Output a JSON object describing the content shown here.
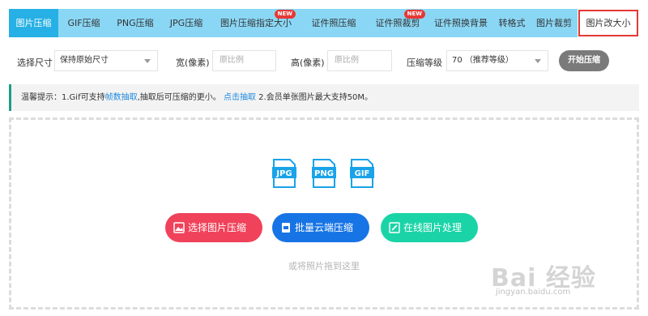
{
  "tabs": [
    {
      "label": "图片压缩"
    },
    {
      "label": "GIF压缩"
    },
    {
      "label": "PNG压缩"
    },
    {
      "label": "JPG压缩"
    },
    {
      "label": "图片压缩指定大小",
      "badge": "NEW"
    },
    {
      "label": "证件照压缩"
    },
    {
      "label": "证件照裁剪",
      "badge": "NEW"
    },
    {
      "label": "证件照换背景"
    },
    {
      "label": "转格式"
    },
    {
      "label": "图片裁剪"
    },
    {
      "label": "图片改大小"
    }
  ],
  "options": {
    "size_label": "选择尺寸",
    "size_value": "保持原始尺寸",
    "width_label": "宽(像素)",
    "width_placeholder": "原比例",
    "height_label": "高(像素)",
    "height_placeholder": "原比例",
    "level_label": "压缩等级",
    "level_value": "70 （推荐等级）",
    "start_button": "开始压缩"
  },
  "tip": {
    "text1": "温馨提示：1.Gif可支持",
    "link1": "帧数抽取",
    "text2": ",抽取后可压缩的更小。",
    "link2": "点击抽取",
    "text3": " 2.会员单张图片最大支持50M。"
  },
  "formats": [
    "JPG",
    "PNG",
    "GIF"
  ],
  "actions": {
    "select": "选择图片压缩",
    "batch": "批量云端压缩",
    "online": "在线图片处理"
  },
  "drop_hint": "或将照片拖到这里",
  "watermark": {
    "logo": "Bai 经验",
    "url": "jingyan.baidu.com"
  },
  "colors": {
    "tab_bar": "#8ad7f5",
    "tab_active": "#26b0e5",
    "highlight": "#e53935",
    "btn_select": "#f0425a",
    "btn_batch": "#1774e5",
    "btn_online": "#1ad4a7",
    "file_icon": "#1aa3e8"
  }
}
